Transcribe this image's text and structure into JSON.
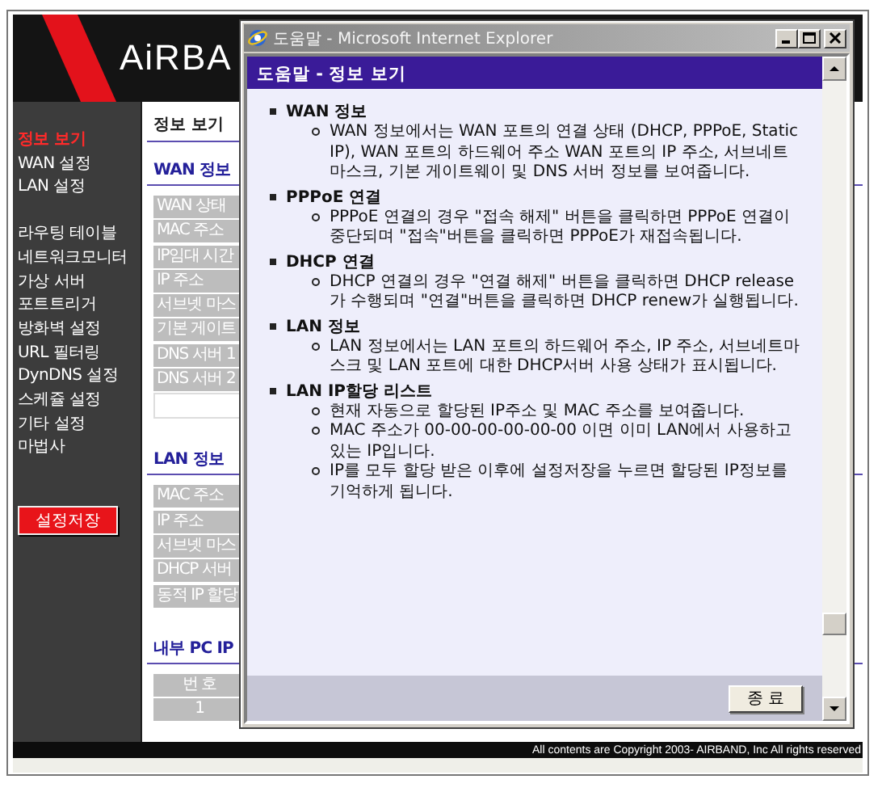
{
  "header": {
    "logo": "AiRBA"
  },
  "sidebar": {
    "groups": [
      [
        {
          "label": "정보 보기",
          "selected": true
        },
        {
          "label": "WAN 설정",
          "selected": false
        },
        {
          "label": "LAN 설정",
          "selected": false
        }
      ],
      [
        {
          "label": "라우팅 테이블",
          "selected": false
        },
        {
          "label": "네트워크모니터",
          "selected": false
        },
        {
          "label": "가상 서버",
          "selected": false
        },
        {
          "label": "포트트리거",
          "selected": false
        },
        {
          "label": "방화벽 설정",
          "selected": false
        },
        {
          "label": "URL 필터링",
          "selected": false
        },
        {
          "label": "DynDNS 설정",
          "selected": false
        },
        {
          "label": "스케쥴 설정",
          "selected": false
        },
        {
          "label": "기타 설정",
          "selected": false
        },
        {
          "label": "마법사",
          "selected": false
        }
      ]
    ],
    "save_button": "설정저장"
  },
  "content": {
    "title": "정보 보기",
    "sections": [
      {
        "heading": "WAN 정보",
        "rows": [
          "WAN 상태",
          "MAC 주소",
          "IP임대 시간",
          "IP 주소",
          "서브넷 마스",
          "기본 게이트",
          "DNS 서버 1",
          "DNS 서버 2"
        ],
        "blank_row": true
      },
      {
        "heading": "LAN 정보",
        "rows": [
          "MAC 주소",
          "IP 주소",
          "서브넷 마스",
          "DHCP 서버",
          "동적 IP 할당"
        ]
      },
      {
        "heading": "내부 PC IP",
        "rows": [
          "번 호",
          "1"
        ]
      }
    ]
  },
  "popup": {
    "title": "도움말 - Microsoft Internet Explorer",
    "header": "도움말 - 정보 보기",
    "topics": [
      {
        "title": "WAN 정보",
        "items": [
          "WAN 정보에서는 WAN 포트의 연결 상태 (DHCP, PPPoE, Static IP), WAN 포트의 하드웨어 주소 WAN 포트의 IP 주소, 서브네트 마스크, 기본 게이트웨이 및 DNS 서버 정보를 보여줍니다."
        ]
      },
      {
        "title": "PPPoE 연결",
        "items": [
          "PPPoE 연결의 경우 \"접속 해제\" 버튼을 클릭하면 PPPoE 연결이 중단되며 \"접속\"버튼을 클릭하면 PPPoE가 재접속됩니다."
        ]
      },
      {
        "title": "DHCP 연결",
        "items": [
          "DHCP 연결의 경우 \"연결 해제\" 버튼을 클릭하면 DHCP release가 수행되며 \"연결\"버튼을 클릭하면 DHCP renew가 실행됩니다."
        ]
      },
      {
        "title": "LAN 정보",
        "items": [
          "LAN 정보에서는 LAN 포트의 하드웨어 주소, IP 주소, 서브네트마스크 및 LAN 포트에 대한 DHCP서버 사용 상태가 표시됩니다."
        ]
      },
      {
        "title": "LAN IP할당 리스트",
        "items": [
          "현재 자동으로 할당된 IP주소 및 MAC 주소를 보여줍니다.",
          "MAC 주소가 00-00-00-00-00-00 이면 이미 LAN에서 사용하고 있는 IP입니다.",
          "IP를 모두 할당 받은 이후에 설정저장을 누르면 할당된 IP정보를 기억하게 됩니다."
        ]
      }
    ],
    "close_button": "종 료"
  },
  "footer": {
    "copyright": "All contents are Copyright 2003- AIRBAND, Inc All rights reserved"
  }
}
